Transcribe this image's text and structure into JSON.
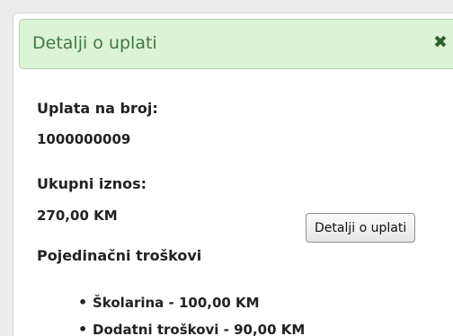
{
  "panel": {
    "title": "Detalji o uplati",
    "close_icon": "close-icon"
  },
  "payment": {
    "number_label": "Uplata na broj:",
    "number_value": "1000000009",
    "total_label": "Ukupni iznos:",
    "total_value": "270,00 KM"
  },
  "details_button": {
    "label": "Detalji o uplati"
  },
  "costs": {
    "label": "Pojedinačni troškovi",
    "items": [
      "Školarina - 100,00 KM",
      "Dodatni troškovi - 90,00 KM"
    ]
  }
}
